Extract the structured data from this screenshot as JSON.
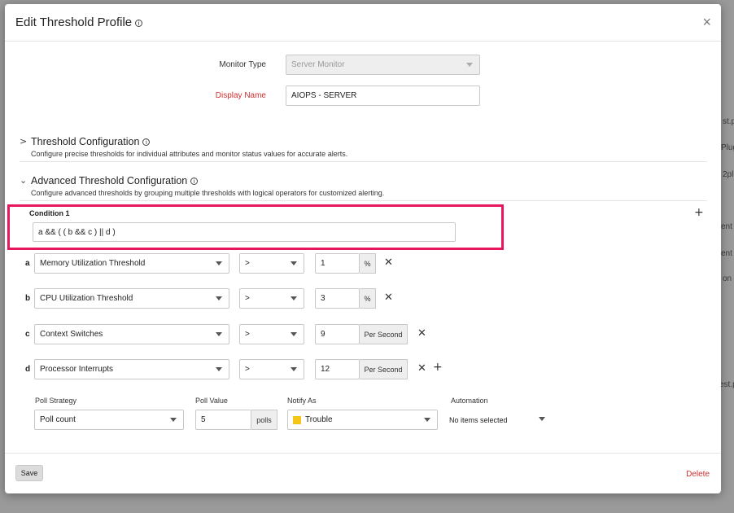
{
  "background": {
    "fragments": [
      "st.py",
      "Plug",
      "2pl.",
      "ent",
      "ent",
      "on",
      "est.py"
    ]
  },
  "modal": {
    "title": "Edit Threshold Profile",
    "close_symbol": "×",
    "monitor_type": {
      "label": "Monitor Type",
      "value": "Server Monitor",
      "disabled": true
    },
    "display_name": {
      "label": "Display Name",
      "value": "AIOPS - SERVER"
    },
    "threshold_config": {
      "title": "Threshold Configuration",
      "description": "Configure precise thresholds for individual attributes and monitor status values for accurate alerts."
    },
    "advanced_config": {
      "title": "Advanced Threshold Configuration",
      "description": "Configure advanced thresholds by grouping multiple thresholds with logical operators for customized alerting."
    },
    "condition": {
      "label": "Condition 1",
      "expression": "a && ( ( b && c ) || d )"
    },
    "rows": [
      {
        "letter": "a",
        "attribute": "Memory Utilization Threshold",
        "operator": ">",
        "value": "1",
        "unit": "%"
      },
      {
        "letter": "b",
        "attribute": "CPU Utilization Threshold",
        "operator": ">",
        "value": "3",
        "unit": "%"
      },
      {
        "letter": "c",
        "attribute": "Context Switches",
        "operator": ">",
        "value": "9",
        "unit": "Per Second"
      },
      {
        "letter": "d",
        "attribute": "Processor Interrupts",
        "operator": ">",
        "value": "12",
        "unit": "Per Second"
      }
    ],
    "poll_strategy": {
      "label": "Poll Strategy",
      "value": "Poll count"
    },
    "poll_value": {
      "label": "Poll Value",
      "value": "5",
      "unit": "polls"
    },
    "notify_as": {
      "label": "Notify As",
      "value": "Trouble",
      "color": "#f5c518"
    },
    "automation": {
      "label": "Automation",
      "value": "No items selected"
    },
    "save_label": "Save",
    "delete_label": "Delete"
  },
  "colors": {
    "accent_highlight": "#e8175d",
    "required_label": "#d03030"
  }
}
